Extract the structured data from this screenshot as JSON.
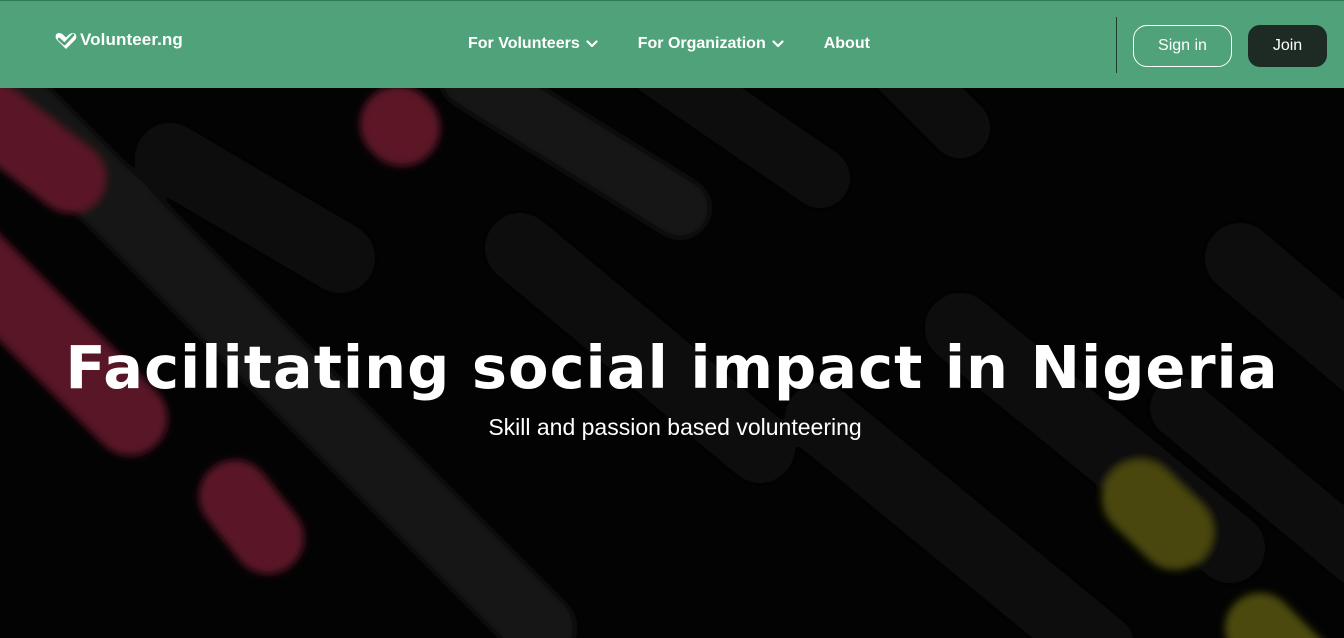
{
  "brand": {
    "logo_text": "Volunteer.ng",
    "logo_icon": "heart-check-icon"
  },
  "nav": {
    "items": [
      {
        "label": "For Volunteers",
        "has_dropdown": true
      },
      {
        "label": "For Organization",
        "has_dropdown": true
      },
      {
        "label": "About",
        "has_dropdown": false
      }
    ],
    "signin_label": "Sign in",
    "join_label": "Join"
  },
  "hero": {
    "title": "Facilitating social impact in Nigeria",
    "subtitle": "Skill and passion based volunteering"
  },
  "colors": {
    "nav_bg": "#4fa27a",
    "join_bg": "#1e2a24",
    "hero_bg": "#030303",
    "accent_red": "#5c1426",
    "accent_yellow": "#4d4a0c"
  }
}
